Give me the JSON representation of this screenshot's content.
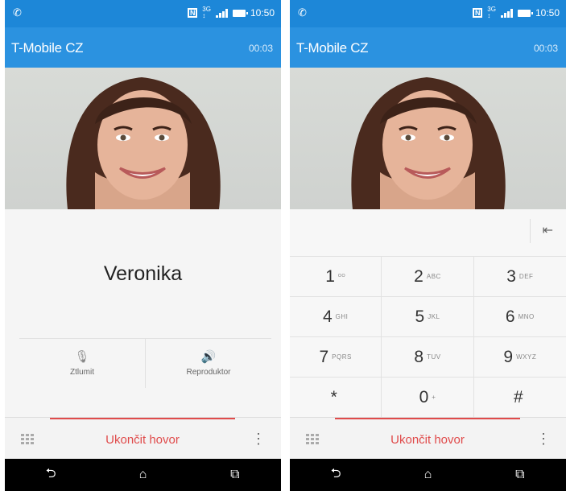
{
  "screens": [
    {
      "status": {
        "time": "10:50"
      },
      "header": {
        "carrier": "T-Mobile CZ",
        "timer": "00:03"
      },
      "contact": {
        "name": "Veronika"
      },
      "actions": [
        {
          "label": "Ztlumit",
          "icon": "mic-off-icon"
        },
        {
          "label": "Reproduktor",
          "icon": "speaker-icon"
        }
      ],
      "end_call": {
        "label": "Ukončit hovor"
      },
      "nav": {
        "back": "⮌",
        "home": "⌂",
        "recents": "⧉"
      }
    },
    {
      "status": {
        "time": "10:50"
      },
      "header": {
        "carrier": "T-Mobile CZ",
        "timer": "00:03"
      },
      "keypad": [
        {
          "digit": "1",
          "letters": "ᴼᴼ"
        },
        {
          "digit": "2",
          "letters": "ABC"
        },
        {
          "digit": "3",
          "letters": "DEF"
        },
        {
          "digit": "4",
          "letters": "GHI"
        },
        {
          "digit": "5",
          "letters": "JKL"
        },
        {
          "digit": "6",
          "letters": "MNO"
        },
        {
          "digit": "7",
          "letters": "PQRS"
        },
        {
          "digit": "8",
          "letters": "TUV"
        },
        {
          "digit": "9",
          "letters": "WXYZ"
        },
        {
          "digit": "*",
          "letters": ""
        },
        {
          "digit": "0",
          "letters": "+"
        },
        {
          "digit": "#",
          "letters": ""
        }
      ],
      "end_call": {
        "label": "Ukončit hovor"
      },
      "nav": {
        "back": "⮌",
        "home": "⌂",
        "recents": "⧉"
      }
    }
  ],
  "colors": {
    "status_bar": "#1d87d8",
    "header_bar": "#2b92e0",
    "end_call": "#e04b4b"
  }
}
